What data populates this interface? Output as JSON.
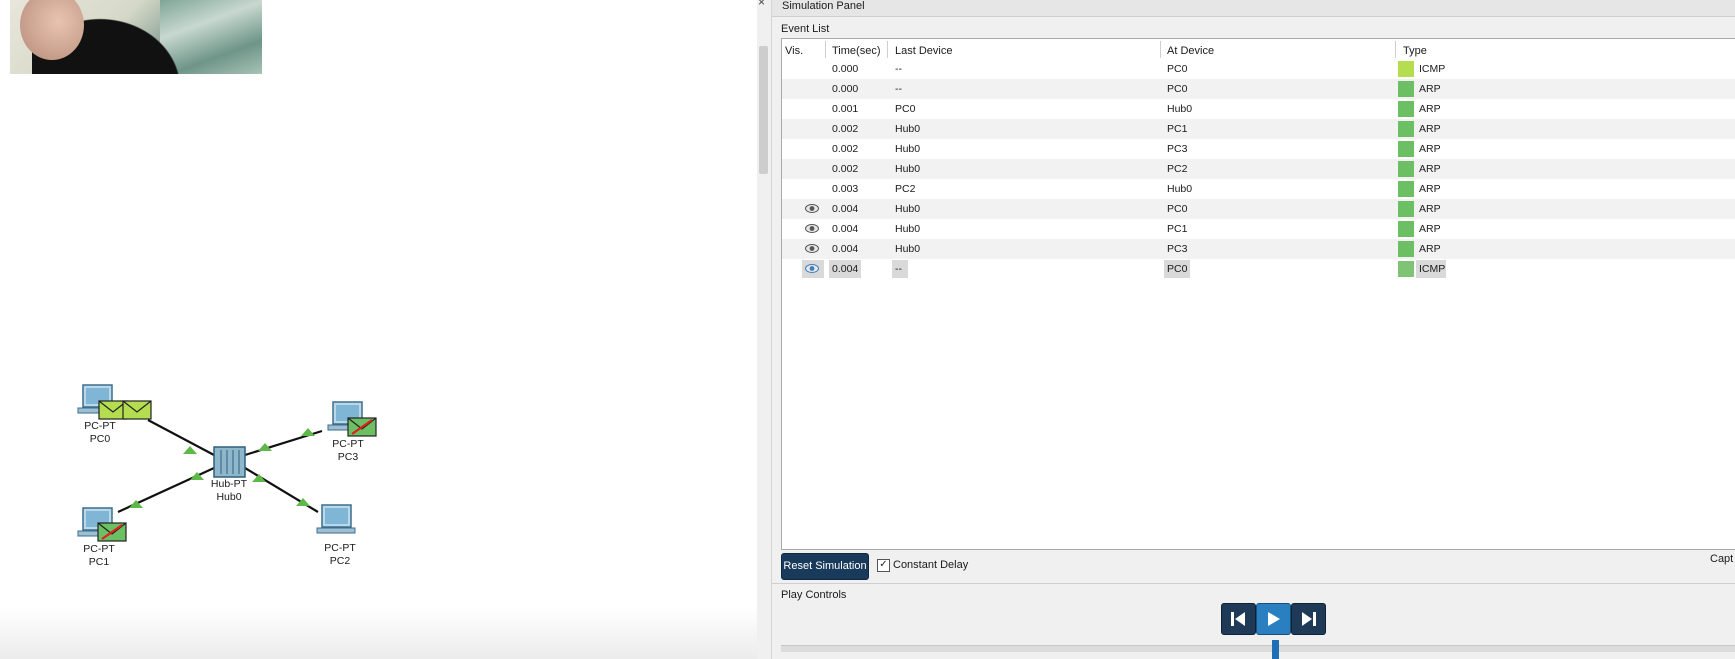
{
  "workspace": {
    "devices": [
      {
        "model": "PC-PT",
        "name": "PC0"
      },
      {
        "model": "PC-PT",
        "name": "PC3"
      },
      {
        "model": "Hub-PT",
        "name": "Hub0"
      },
      {
        "model": "PC-PT",
        "name": "PC1"
      },
      {
        "model": "PC-PT",
        "name": "PC2"
      }
    ]
  },
  "panel": {
    "title": "Simulation Panel",
    "event_list_label": "Event List",
    "columns": [
      "Vis.",
      "Time(sec)",
      "Last Device",
      "At Device",
      "Type"
    ],
    "events": [
      {
        "vis": "",
        "time": "0.000",
        "last": "--",
        "at": "PC0",
        "type": "ICMP",
        "color": "#b5dd50"
      },
      {
        "vis": "",
        "time": "0.000",
        "last": "--",
        "at": "PC0",
        "type": "ARP",
        "color": "#6cbf63"
      },
      {
        "vis": "",
        "time": "0.001",
        "last": "PC0",
        "at": "Hub0",
        "type": "ARP",
        "color": "#6cbf63"
      },
      {
        "vis": "",
        "time": "0.002",
        "last": "Hub0",
        "at": "PC1",
        "type": "ARP",
        "color": "#6cbf63"
      },
      {
        "vis": "",
        "time": "0.002",
        "last": "Hub0",
        "at": "PC3",
        "type": "ARP",
        "color": "#6cbf63"
      },
      {
        "vis": "",
        "time": "0.002",
        "last": "Hub0",
        "at": "PC2",
        "type": "ARP",
        "color": "#6cbf63"
      },
      {
        "vis": "",
        "time": "0.003",
        "last": "PC2",
        "at": "Hub0",
        "type": "ARP",
        "color": "#6cbf63"
      },
      {
        "vis": "eye-icon",
        "time": "0.004",
        "last": "Hub0",
        "at": "PC0",
        "type": "ARP",
        "color": "#6cbf63"
      },
      {
        "vis": "eye-icon",
        "time": "0.004",
        "last": "Hub0",
        "at": "PC1",
        "type": "ARP",
        "color": "#6cbf63"
      },
      {
        "vis": "eye-icon",
        "time": "0.004",
        "last": "Hub0",
        "at": "PC3",
        "type": "ARP",
        "color": "#6cbf63"
      },
      {
        "vis": "eye-icon-active",
        "time": "0.004",
        "last": "--",
        "at": "PC0",
        "type": "ICMP",
        "color": "#7fc474"
      }
    ],
    "reset_label": "Reset Simulation",
    "constant_delay_label": "Constant Delay",
    "constant_delay_checked": true,
    "capture_label": "Capt",
    "play_controls_label": "Play Controls"
  }
}
